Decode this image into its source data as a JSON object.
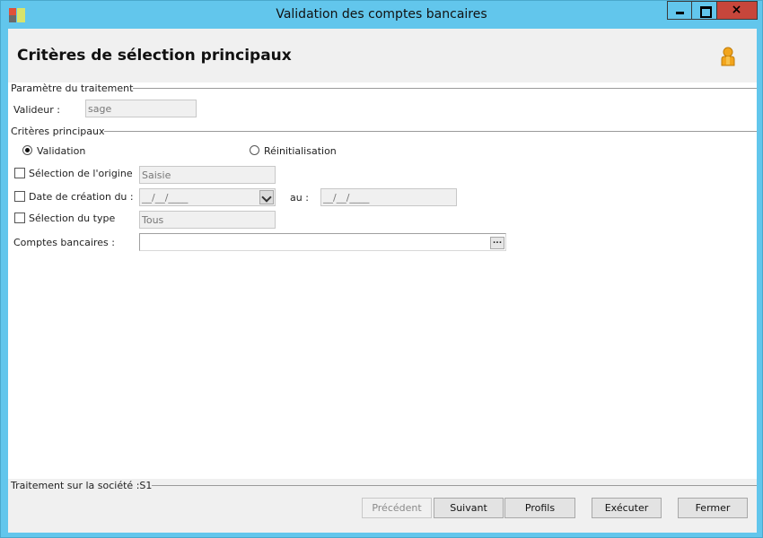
{
  "window": {
    "title": "Validation des comptes bancaires",
    "close_glyph": "×"
  },
  "icons": {
    "app": "app-icon",
    "user": "user-icon",
    "minimize": "minimize-icon",
    "maximize": "maximize-icon",
    "close": "close-icon",
    "dropdown": "chevron-down-icon",
    "ellipsis": "ellipsis-icon"
  },
  "header": {
    "title": "Critères de sélection principaux"
  },
  "treatment_params": {
    "legend": "Paramètre du traitement",
    "validator_label": "Valideur :",
    "validator_value": "sage"
  },
  "main_criteria": {
    "legend": "Critères principaux",
    "radio_validation": {
      "label": "Validation",
      "checked": true
    },
    "radio_reinit": {
      "label": "Réinitialisation",
      "checked": false
    },
    "origin": {
      "label": "Sélection de l'origine",
      "value": "Saisie",
      "checked": false
    },
    "creation_date": {
      "label": "Date de création du :",
      "value": "__/__/____",
      "to_label": "au :",
      "to_value": "__/__/____",
      "checked": false
    },
    "type": {
      "label": "Sélection du type",
      "value": "Tous",
      "checked": false
    },
    "bank_accounts": {
      "label": "Comptes bancaires :",
      "value": "",
      "button": "..."
    }
  },
  "footer": {
    "company_text": "Traitement sur la société :S1",
    "buttons": {
      "previous": "Précédent",
      "next": "Suivant",
      "profiles": "Profils",
      "execute": "Exécuter",
      "close": "Fermer"
    }
  },
  "colors": {
    "titlebar": "#62c6ec",
    "close_button": "#c7463b",
    "header_bg": "#f0f0f0"
  }
}
